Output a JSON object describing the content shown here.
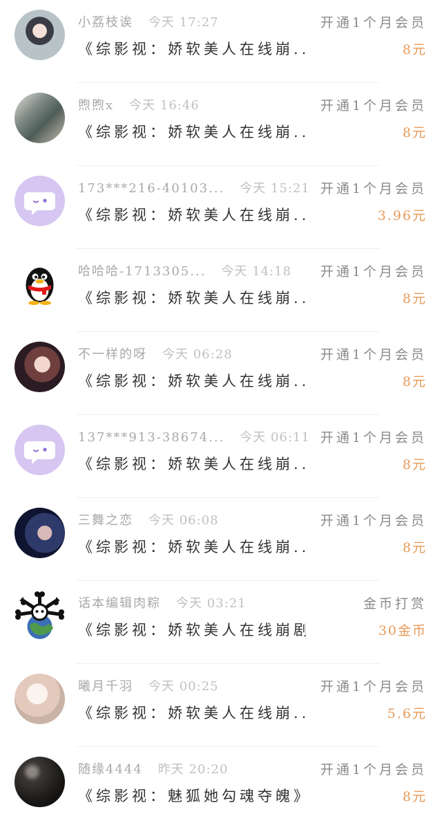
{
  "rows": [
    {
      "username": "小荔枝诶",
      "time": "今天 17:27",
      "title": "《综影视：娇软美人在线崩...",
      "action": "开通1个月会员",
      "amount": "8元",
      "avatar": "girl-illustration-avatar"
    },
    {
      "username": "煦煦x",
      "time": "今天 16:46",
      "title": "《综影视：娇软美人在线崩...",
      "action": "开通1个月会员",
      "amount": "8元",
      "avatar": "photo-avatar"
    },
    {
      "username": "173***216-40103...",
      "time": "今天 15:21",
      "title": "《综影视：娇软美人在线崩...",
      "action": "开通1个月会员",
      "amount": "3.96元",
      "avatar": "default-chat-avatar"
    },
    {
      "username": "哈哈哈-1713305...",
      "time": "今天 14:18",
      "title": "《综影视：娇软美人在线崩...",
      "action": "开通1个月会员",
      "amount": "8元",
      "avatar": "qq-penguin-avatar"
    },
    {
      "username": "不一样的呀",
      "time": "今天 06:28",
      "title": "《综影视：娇软美人在线崩...",
      "action": "开通1个月会员",
      "amount": "8元",
      "avatar": "girl-avatar"
    },
    {
      "username": "137***913-38674...",
      "time": "今天 06:11",
      "title": "《综影视：娇软美人在线崩...",
      "action": "开通1个月会员",
      "amount": "8元",
      "avatar": "default-chat-avatar"
    },
    {
      "username": "三舞之恋",
      "time": "今天 06:08",
      "title": "《综影视：娇软美人在线崩...",
      "action": "开通1个月会员",
      "amount": "8元",
      "avatar": "couple-avatar"
    },
    {
      "username": "话本编辑肉粽",
      "time": "今天 03:21",
      "title": "《综影视：娇软美人在线崩剧情》",
      "action": "金币打赏",
      "amount": "30金币",
      "avatar": "bone-globe-avatar"
    },
    {
      "username": "曦月千羽",
      "time": "今天 00:25",
      "title": "《综影视：娇软美人在线崩...",
      "action": "开通1个月会员",
      "amount": "5.6元",
      "avatar": "pale-girl-avatar"
    },
    {
      "username": "随缘4444",
      "time": "昨天 20:20",
      "title": "《综影视：魅狐她勾魂夺魄》",
      "action": "开通1个月会员",
      "amount": "8元",
      "avatar": "dark-sphere-avatar"
    }
  ],
  "colors": {
    "amount": "#e89a58",
    "purple_avatar": "#d6c6f1"
  }
}
